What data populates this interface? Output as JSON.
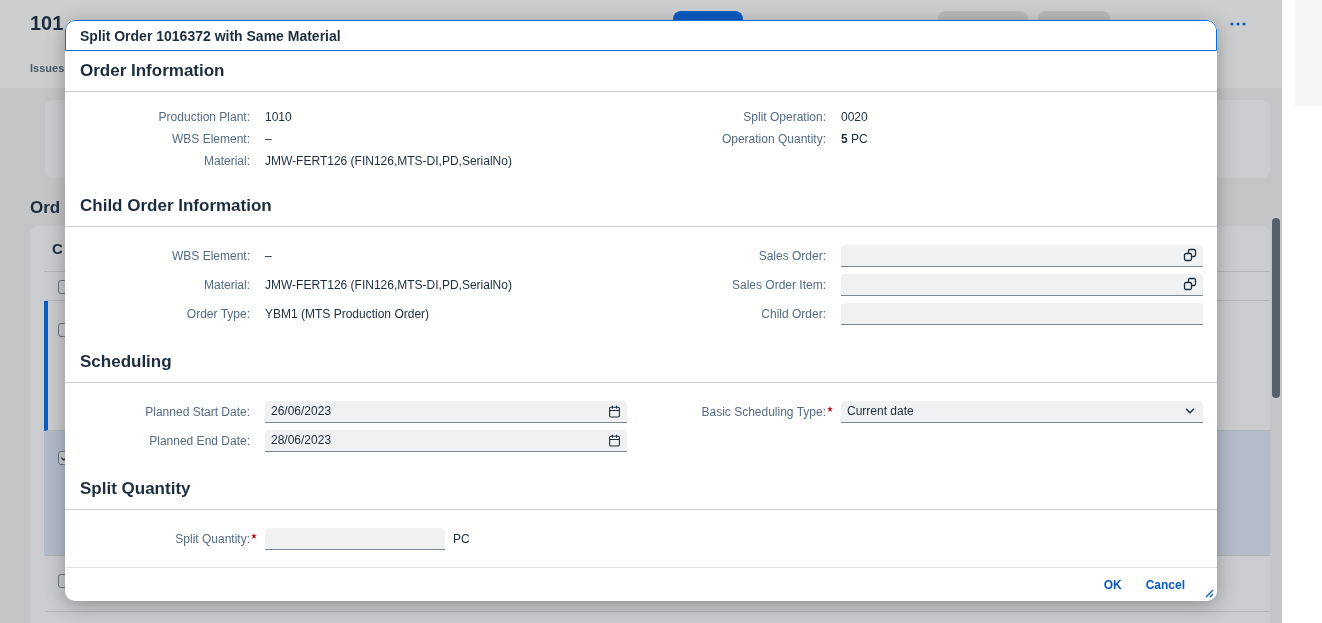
{
  "background": {
    "title": "101",
    "tab": "Issues",
    "section_title": "Ord",
    "table_header": "C",
    "rows": [
      {
        "selected": false,
        "focused": false
      },
      {
        "selected": false,
        "focused": true
      },
      {
        "selected": true,
        "focused": false
      },
      {
        "selected": false,
        "focused": false
      }
    ]
  },
  "dialog": {
    "title": "Split Order 1016372 with Same Material",
    "sections": [
      {
        "title": "Order Information",
        "left": [
          {
            "kind": "text",
            "label": "Production Plant:",
            "value": "1010",
            "required": false
          },
          {
            "kind": "text",
            "label": "WBS Element:",
            "value": "–",
            "required": false
          },
          {
            "kind": "text",
            "label": "Material:",
            "value": "JMW-FERT126 (FIN126,MTS-DI,PD,SerialNo)",
            "required": false
          }
        ],
        "right": [
          {
            "kind": "text",
            "label": "Split Operation:",
            "value": "0020",
            "required": false
          },
          {
            "kind": "text",
            "label": "Operation Quantity:",
            "value": "**5** PC",
            "required": false
          }
        ]
      },
      {
        "title": "Child Order Information",
        "left": [
          {
            "kind": "text",
            "label": "WBS Element:",
            "value": "–",
            "required": false
          },
          {
            "kind": "text",
            "label": "Material:",
            "value": "JMW-FERT126 (FIN126,MTS-DI,PD,SerialNo)",
            "required": false
          },
          {
            "kind": "text",
            "label": "Order Type:",
            "value": "YBM1 (MTS Production Order)",
            "required": false
          }
        ],
        "right": [
          {
            "kind": "value_help",
            "label": "Sales Order:",
            "required": false
          },
          {
            "kind": "value_help",
            "label": "Sales Order Item:",
            "required": false
          },
          {
            "kind": "input",
            "label": "Child Order:",
            "required": false
          }
        ]
      },
      {
        "title": "Scheduling",
        "left": [
          {
            "kind": "date",
            "label": "Planned Start Date:",
            "value": "26/06/2023",
            "required": false
          },
          {
            "kind": "date",
            "label": "Planned End Date:",
            "value": "28/06/2023",
            "required": false
          }
        ],
        "right": [
          {
            "kind": "select",
            "label": "Basic Scheduling Type:",
            "value": "Current date",
            "required": true
          }
        ]
      },
      {
        "title": "Split Quantity",
        "left": [
          {
            "kind": "quantity",
            "label": "Split Quantity:",
            "unit": "PC",
            "required": true
          }
        ]
      }
    ],
    "buttons": [
      "OK",
      "Cancel"
    ]
  }
}
